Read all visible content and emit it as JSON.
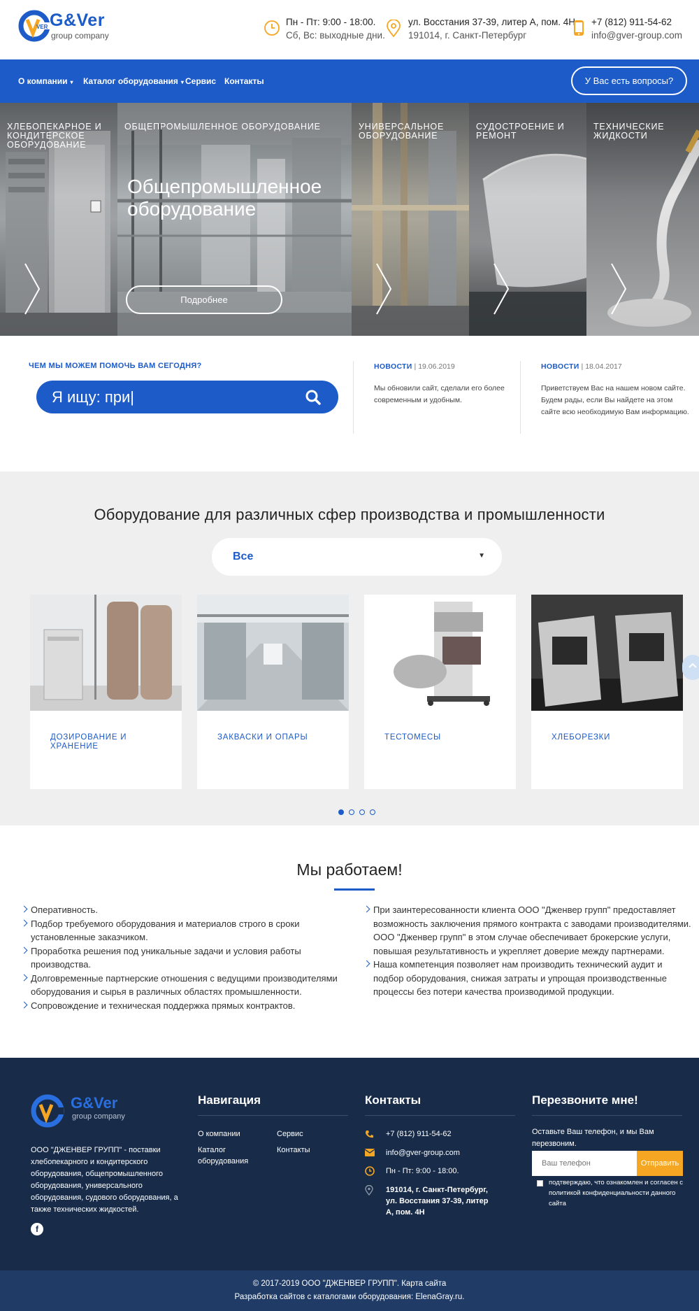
{
  "header": {
    "logo_text": "G&Ver",
    "logo_sub": "group company",
    "logo_mark": "VER",
    "hours_line1": "Пн - Пт: 9:00 - 18:00.",
    "hours_line2": "Сб, Вс: выходные дни.",
    "address_line1": "ул. Восстания 37-39, литер А, пом. 4Н",
    "address_line2": "191014, г. Санкт-Петербург",
    "phone": "+7 (812) 911-54-62",
    "email": "info@gver-group.com",
    "icon_color": "#f5a623"
  },
  "nav": {
    "items": [
      {
        "label": "О компании",
        "has_dropdown": true
      },
      {
        "label": "Каталог оборудования",
        "has_dropdown": true
      },
      {
        "label": "Сервис",
        "has_dropdown": false
      },
      {
        "label": "Контакты",
        "has_dropdown": false
      }
    ],
    "caret": "▾",
    "ask_button": "У Вас есть вопросы?"
  },
  "hero": {
    "panels": [
      {
        "label": "Хлебопекарное и кондитерское оборудование"
      },
      {
        "label": "Общепромышленное оборудование"
      },
      {
        "label": "Универсальное оборудование"
      },
      {
        "label": "Судостроение и ремонт"
      },
      {
        "label": "Технические жидкости"
      }
    ],
    "active_title": "Общепромышленное оборудование",
    "more_button": "Подробнее"
  },
  "help": {
    "title": "ЧЕМ МЫ МОЖЕМ ПОМОЧЬ ВАМ СЕГОДНЯ?",
    "search_text": "Я ищу: при|"
  },
  "news": [
    {
      "tag": "НОВОСТИ",
      "date": "19.06.2019",
      "text": "Мы обновили сайт, сделали его более современным и удобным."
    },
    {
      "tag": "НОВОСТИ",
      "date": "18.04.2017",
      "text": "Приветствуем Вас на нашем новом сайте. Будем рады, если Вы найдете на этом сайте всю необходимую Вам информацию."
    }
  ],
  "equipment": {
    "title": "Оборудование для различных сфер производства и промышленности",
    "select_value": "Все",
    "cards": [
      {
        "name": "Дозирование и хранение"
      },
      {
        "name": "Закваски и опары"
      },
      {
        "name": "Тестомесы"
      },
      {
        "name": "Хлеборезки"
      }
    ],
    "pager_active": 1,
    "pager_total": 4
  },
  "work": {
    "title": "Мы работаем!",
    "left": [
      "Оперативность.",
      "Подбор требуемого оборудования и материалов строго в сроки установленные заказчиком.",
      "Проработка решения под уникальные задачи и условия работы производства.",
      "Долговременные партнерские отношения с ведущими производителями оборудования и сырья в различных областях промышленности.",
      "Сопровождение и техническая поддержка прямых контрактов."
    ],
    "right": [
      "При заинтересованности клиента ООО \"Дженвер групп\" предоставляет возможность заключения прямого контракта с заводами производителями. ООО \"Дженвер групп\" в этом случае обеспечивает брокерские услуги, повышая результативность и укрепляет доверие между партнерами.",
      "Наша компетенция позволяет нам производить технический аудит и подбор оборудования, снижая затраты и упрощая производственные процессы без потери качества производимой продукции."
    ]
  },
  "footer": {
    "about": "ООО \"ДЖЕНВЕР ГРУПП\" - поставки хлебопекарного и кондитерского оборудования, общепромышленного оборудования, универсального оборудования, судового оборудования, а также технических жидкостей.",
    "social_label": "f",
    "nav_title": "Навигация",
    "nav_links": [
      "О компании",
      "Каталог оборудования",
      "Сервис",
      "Контакты"
    ],
    "contacts_title": "Контакты",
    "contacts": {
      "phone": "+7 (812) 911-54-62",
      "email": "info@gver-group.com",
      "hours": "Пн - Пт: 9:00 - 18:00.",
      "address": "191014, г. Санкт-Петербург, ул. Восстания 37-39, литер А, пом. 4Н"
    },
    "callback_title": "Перезвоните мне!",
    "callback_text": "Оставьте Ваш телефон, и мы Вам перезвоним.",
    "callback_placeholder": "Ваш телефон",
    "callback_button": "Отправить",
    "consent": "подтверждаю, что ознакомлен и согласен с политикой конфиденциальности данного сайта",
    "copyright": "© 2017-2019 ООО \"ДЖЕНВЕР ГРУПП\".  Карта сайта",
    "developer": "Разработка  сайтов с каталогами оборудования: ElenaGray.ru."
  }
}
